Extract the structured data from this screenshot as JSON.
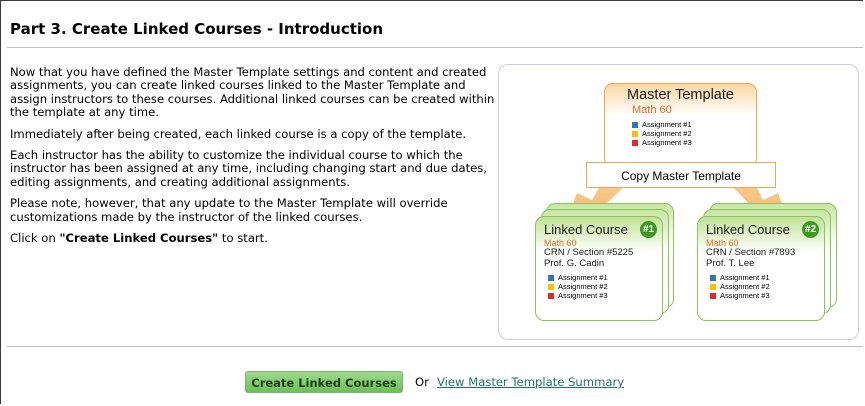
{
  "page": {
    "title": "Part 3. Create Linked Courses - Introduction"
  },
  "intro": {
    "p1": "Now that you have defined the Master Template settings and content and created assignments, you can create linked courses linked to the Master Template and assign instructors to these courses. Additional linked courses can be created within the template at any time.",
    "p2": "Immediately after being created, each linked course is a copy of the template.",
    "p3": "Each instructor has the ability to customize the individual course to which the instructor has been assigned at any time, including changing start and due dates, editing assignments, and creating additional assignments.",
    "p4": "Please note, however, that any update to the Master Template will override customizations made by the instructor of the linked courses.",
    "p5_pre": "Click on ",
    "p5_bold": "\"Create Linked Courses\"",
    "p5_post": " to start."
  },
  "diagram": {
    "master": {
      "title": "Master Template",
      "course": "Math 60",
      "assignments": [
        "Assignment #1",
        "Assignment #2",
        "Assignment #3"
      ]
    },
    "copy_label": "Copy Master Template",
    "linked": [
      {
        "title": "Linked Course",
        "number": "#1",
        "course": "Math 60",
        "crn": "CRN / Section #5225",
        "prof": "Prof. G. Cadin",
        "assignments": [
          "Assignment #1",
          "Assignment #2",
          "Assignment #3"
        ]
      },
      {
        "title": "Linked Course",
        "number": "#2",
        "course": "Math 60",
        "crn": "CRN / Section #7893",
        "prof": "Prof. T. Lee",
        "assignments": [
          "Assignment #1",
          "Assignment #2",
          "Assignment #3"
        ]
      }
    ],
    "colors": {
      "assignment_1": "#2f75c4",
      "assignment_2": "#f2c300",
      "assignment_3": "#e02b2b",
      "course_accent": "#e86a2a",
      "linked_badge": "#3c9a1e"
    }
  },
  "actions": {
    "create_button": "Create Linked Courses",
    "or_text": "Or",
    "summary_link": "View Master Template Summary"
  }
}
